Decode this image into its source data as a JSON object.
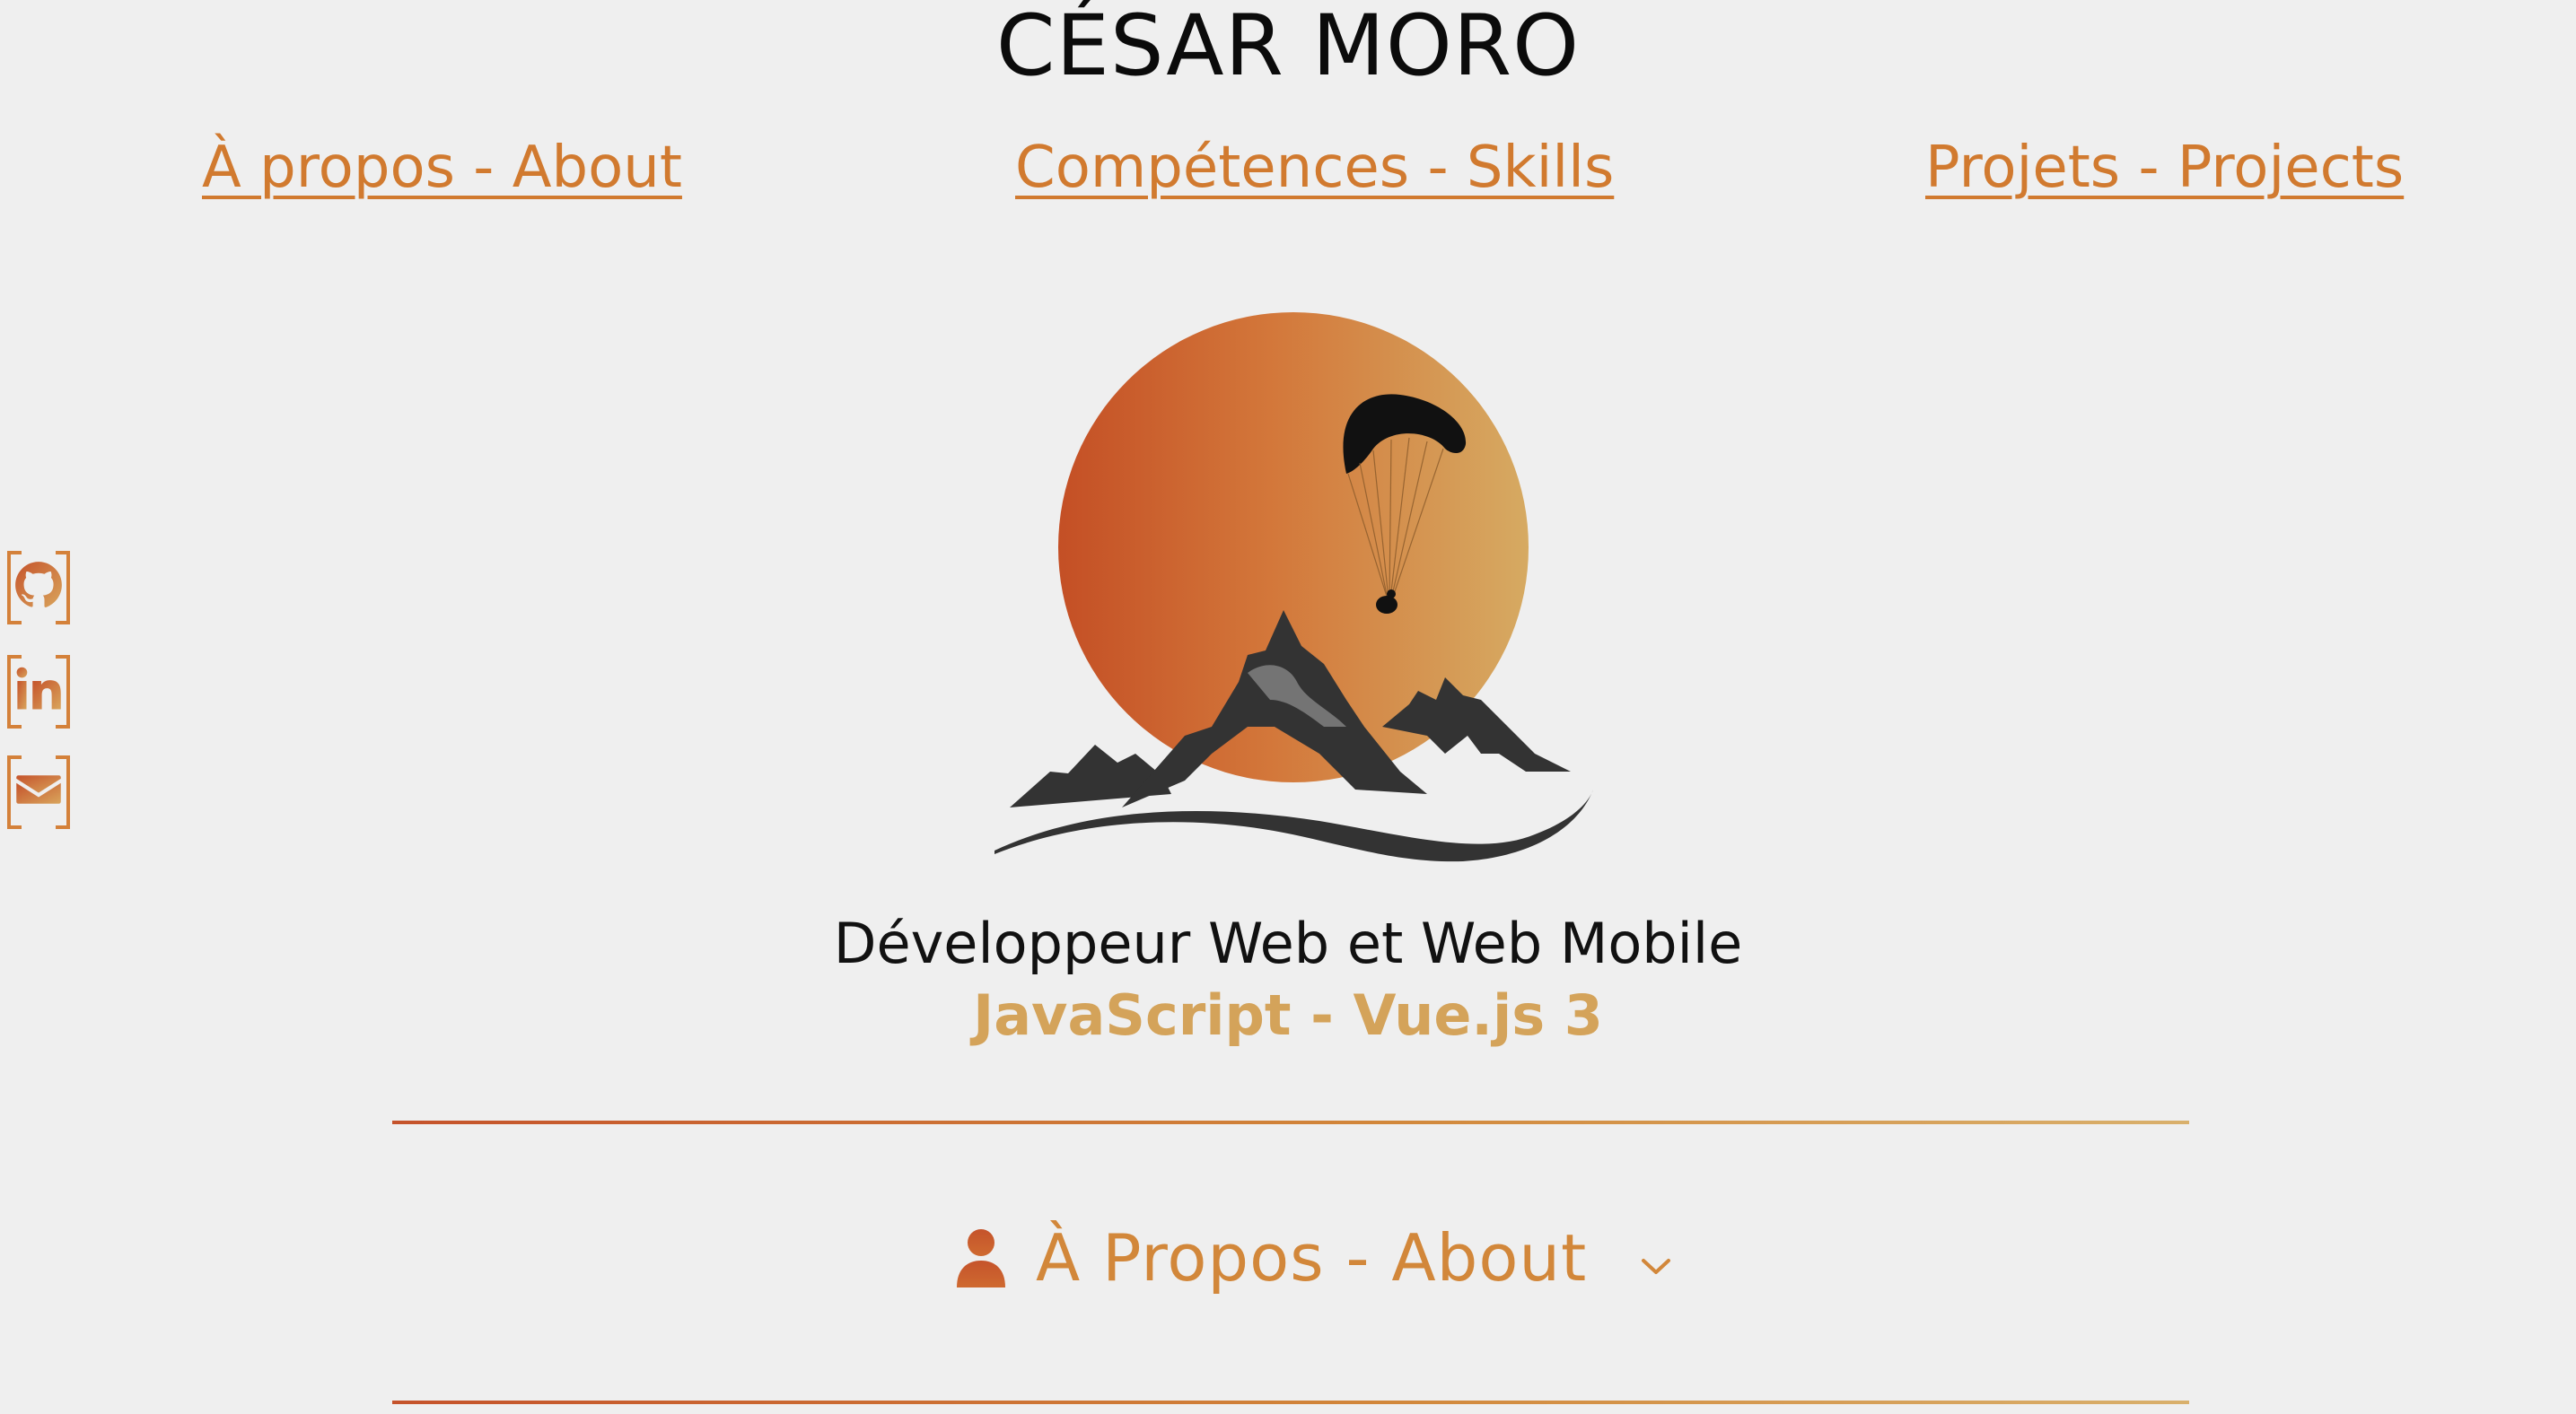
{
  "header": {
    "site_title": "CÉSAR MORO"
  },
  "nav": {
    "about": "À propos - About",
    "skills": "Compétences - Skills",
    "projects": "Projets - Projects"
  },
  "social": {
    "github_icon": "github-icon",
    "linkedin_icon": "linkedin-icon",
    "email_icon": "envelope-icon"
  },
  "hero": {
    "tagline": "Développeur Web et Web Mobile",
    "stack": "JavaScript - Vue.js 3"
  },
  "about_section": {
    "title": "À Propos - About",
    "icon": "user-icon",
    "toggle_icon": "chevron-down-icon"
  },
  "colors": {
    "accent": "#d17a2f",
    "accent_gold": "#d4a35a",
    "accent_red": "#c5532b",
    "background": "#efefef",
    "mountain": "#333333"
  }
}
